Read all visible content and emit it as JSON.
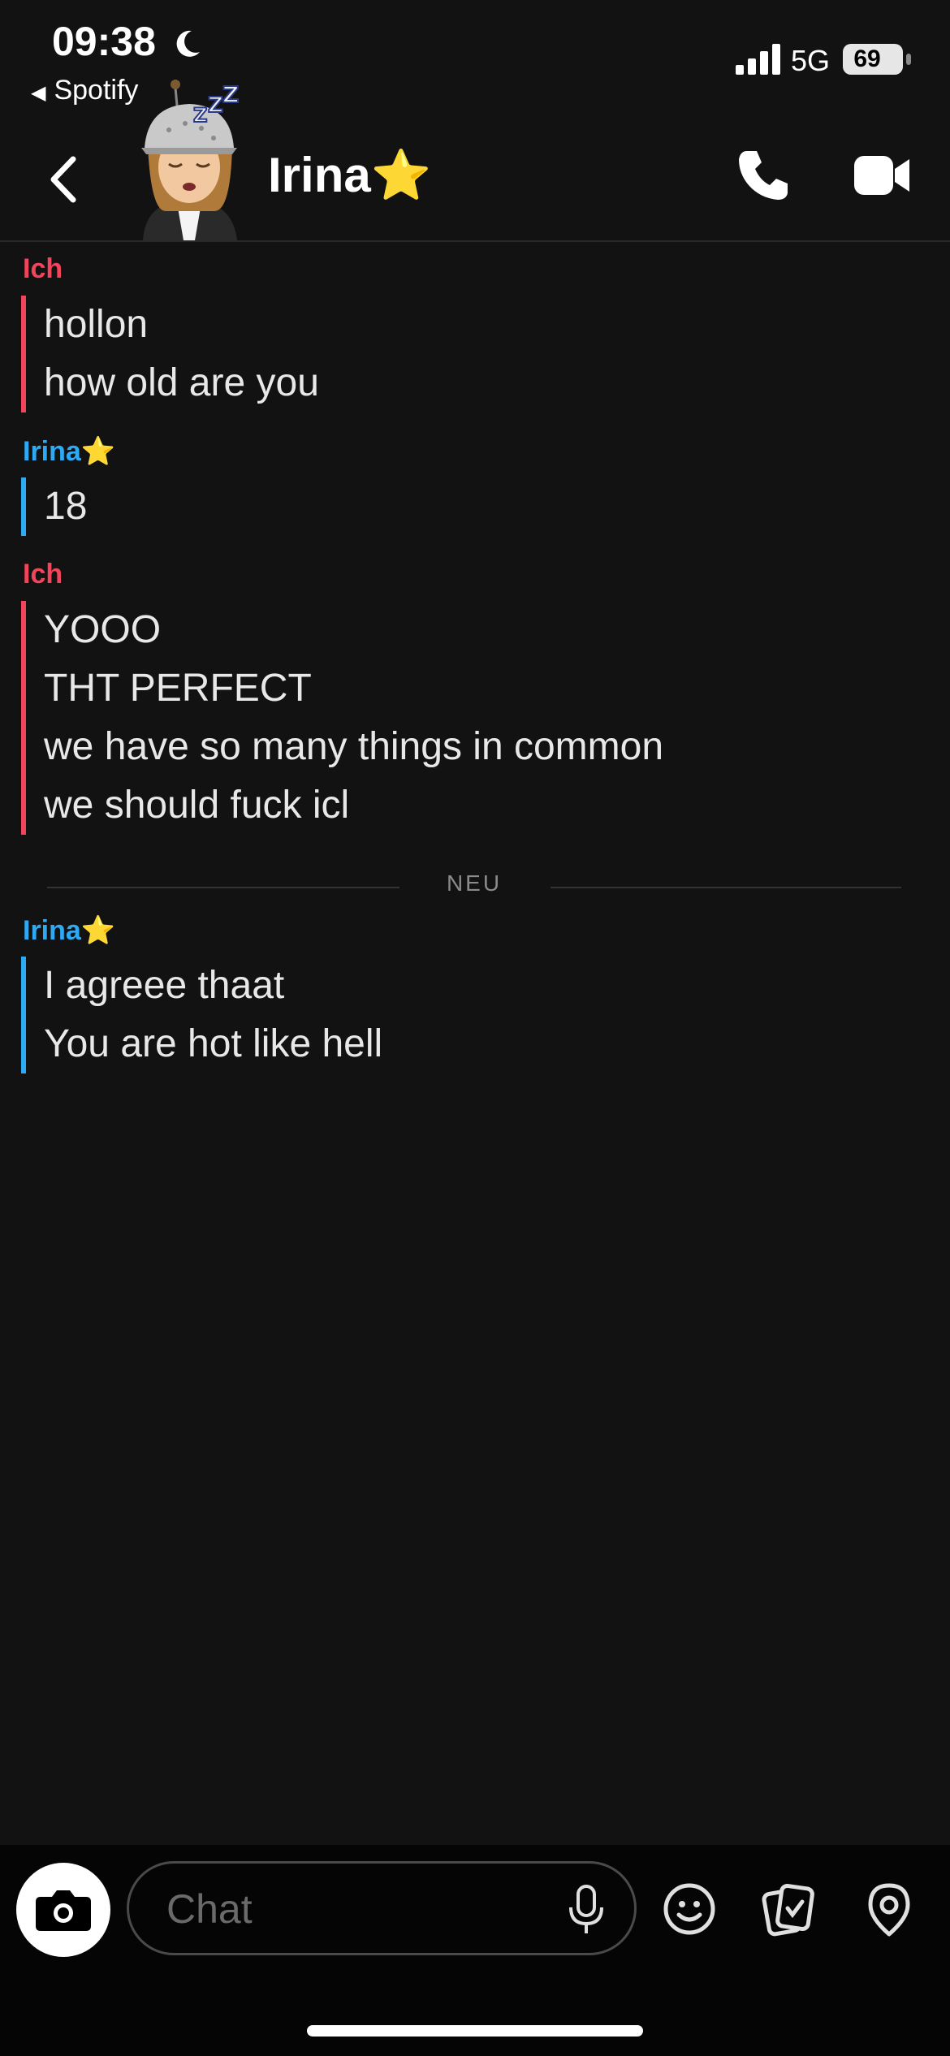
{
  "status_bar": {
    "time": "09:38",
    "back_app": "Spotify",
    "network": "5G",
    "battery": "69"
  },
  "header": {
    "title": "Irina⭐",
    "icons": [
      "back-icon",
      "avatar",
      "phone-icon",
      "video-icon"
    ]
  },
  "messages": [
    {
      "sender": "Ich",
      "role": "me",
      "lines": [
        "hollon",
        "how old are you"
      ]
    },
    {
      "sender": "Irina⭐",
      "role": "them",
      "lines": [
        "18"
      ]
    },
    {
      "sender": "Ich",
      "role": "me",
      "lines": [
        "YOOO",
        "THT PERFECT",
        "we have so many things in common",
        "we should fuck icl"
      ]
    },
    {
      "sender": "Irina⭐",
      "role": "them",
      "lines": [
        "I agreee thaat",
        "You are hot like hell"
      ]
    }
  ],
  "divider_label": "NEU",
  "composer": {
    "placeholder": "Chat",
    "icons": [
      "camera-icon",
      "mic-icon",
      "emoji-icon",
      "stickers-icon",
      "location-icon"
    ]
  },
  "colors": {
    "me": "#f2445a",
    "them": "#2eaaf5",
    "background": "#121212"
  }
}
